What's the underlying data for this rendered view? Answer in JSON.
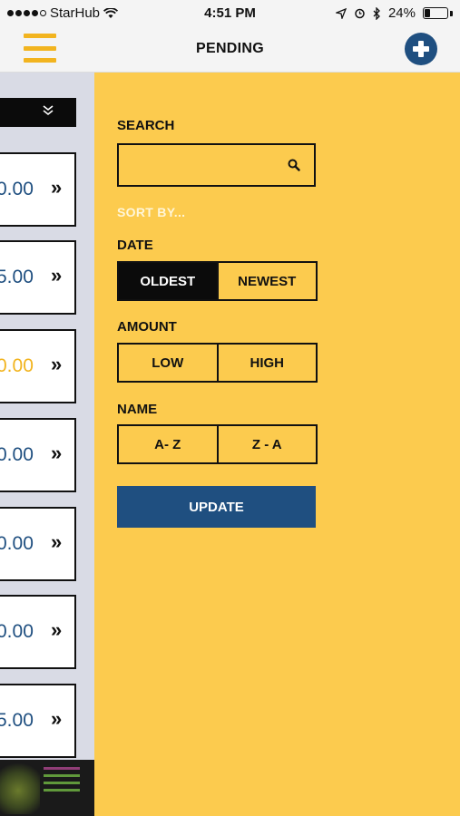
{
  "status_bar": {
    "carrier": "StarHub",
    "time": "4:51 PM",
    "battery_text": "24%",
    "battery_level": 0.24
  },
  "nav": {
    "title": "PENDING"
  },
  "list": {
    "items": [
      {
        "amount": "0.00",
        "arrow": "»",
        "highlight": false
      },
      {
        "amount": "5.00",
        "arrow": "»",
        "highlight": false
      },
      {
        "amount": "0.00",
        "arrow": "»",
        "highlight": true
      },
      {
        "amount": "0.00",
        "arrow": "»",
        "highlight": false
      },
      {
        "amount": "0.00",
        "arrow": "»",
        "highlight": false
      },
      {
        "amount": "0.00",
        "arrow": "»",
        "highlight": false
      },
      {
        "amount": "5.00",
        "arrow": "»",
        "highlight": false
      }
    ]
  },
  "filters": {
    "search_label": "SEARCH",
    "search_value": "",
    "sort_by_label": "SORT BY...",
    "date_label": "DATE",
    "date_options": [
      "OLDEST",
      "NEWEST"
    ],
    "date_selected": "OLDEST",
    "amount_label": "AMOUNT",
    "amount_options": [
      "LOW",
      "HIGH"
    ],
    "name_label": "NAME",
    "name_options": [
      "A- Z",
      "Z - A"
    ],
    "update_label": "UPDATE"
  },
  "colors": {
    "panel_yellow": "#fccb4e",
    "accent_blue": "#1f4f80",
    "menu_yellow": "#f2b41f",
    "active_black": "#0b0b0b"
  }
}
